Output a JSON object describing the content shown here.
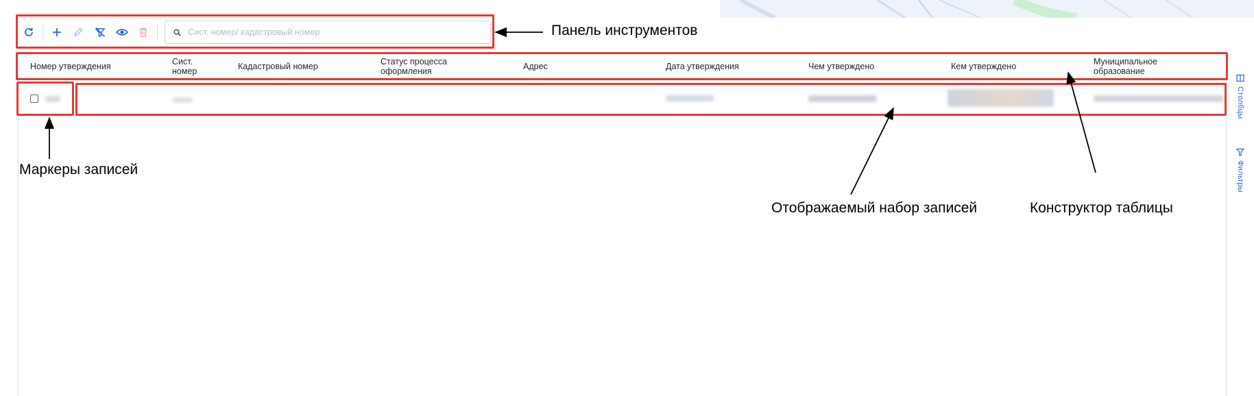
{
  "toolbar": {
    "buttons": [
      {
        "name": "refresh-button",
        "icon": "refresh-icon",
        "color": "#2b63d9"
      },
      {
        "name": "add-button",
        "icon": "plus-icon",
        "color": "#2b63d9"
      },
      {
        "name": "edit-button",
        "icon": "pencil-icon",
        "color": "#9db6ea"
      },
      {
        "name": "clear-filter-button",
        "icon": "filter-off-icon",
        "color": "#2b63d9"
      },
      {
        "name": "view-button",
        "icon": "eye-icon",
        "color": "#2b63d9"
      },
      {
        "name": "delete-button",
        "icon": "trash-icon",
        "color": "#f2a5a5"
      }
    ],
    "search": {
      "placeholder": "Сист. номер/ кадастровый номер",
      "value": ""
    }
  },
  "table": {
    "columns": [
      "Номер утверждения",
      "Сист. номер",
      "Кадастровый номер",
      "Статус процесса оформления",
      "Адрес",
      "Дата утверждения",
      "Чем утверждено",
      "Кем утверждено",
      "Муниципальное образование"
    ]
  },
  "side_panel": {
    "columns_tab": {
      "label": "Столбцы",
      "icon": "columns-icon"
    },
    "filters_tab": {
      "label": "Фильтры",
      "icon": "filter-icon"
    }
  },
  "annotations": {
    "toolbar": "Панель инструментов",
    "record_markers": "Маркеры записей",
    "record_set": "Отображаемый набор записей",
    "table_builder": "Конструктор таблицы"
  },
  "colors": {
    "accent": "#2b63d9",
    "highlight": "#e53935",
    "map_bg": "#eef3fb"
  }
}
